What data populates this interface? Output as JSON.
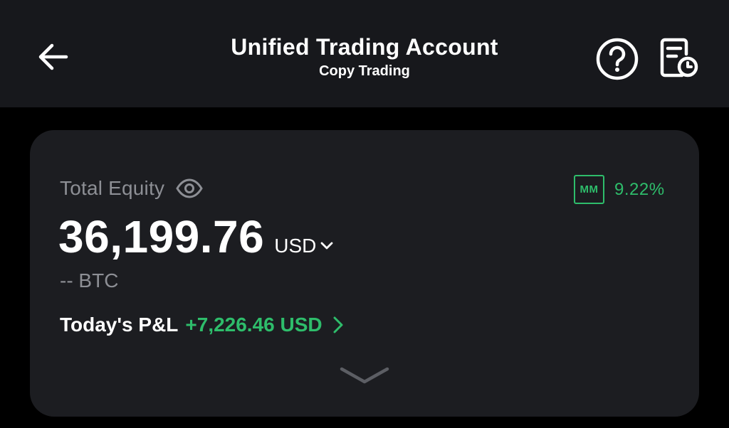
{
  "header": {
    "title": "Unified Trading Account",
    "subtitle": "Copy Trading",
    "icons": [
      "arrow-left-icon",
      "help-circle-icon",
      "order-history-icon"
    ]
  },
  "card": {
    "equity_label": "Total Equity",
    "equity_value": "36,199.76",
    "currency": "USD",
    "btc_value": "-- BTC",
    "pnl_label": "Today's P&L",
    "pnl_value": "+7,226.46 USD",
    "mm_badge": "MM",
    "mm_rate": "9.22%"
  },
  "colors": {
    "header_bg": "#17181c",
    "card_bg": "#1c1d21",
    "page_bg": "#000000",
    "positive_green": "#2ebd6b",
    "muted_text": "#8d8f95"
  }
}
